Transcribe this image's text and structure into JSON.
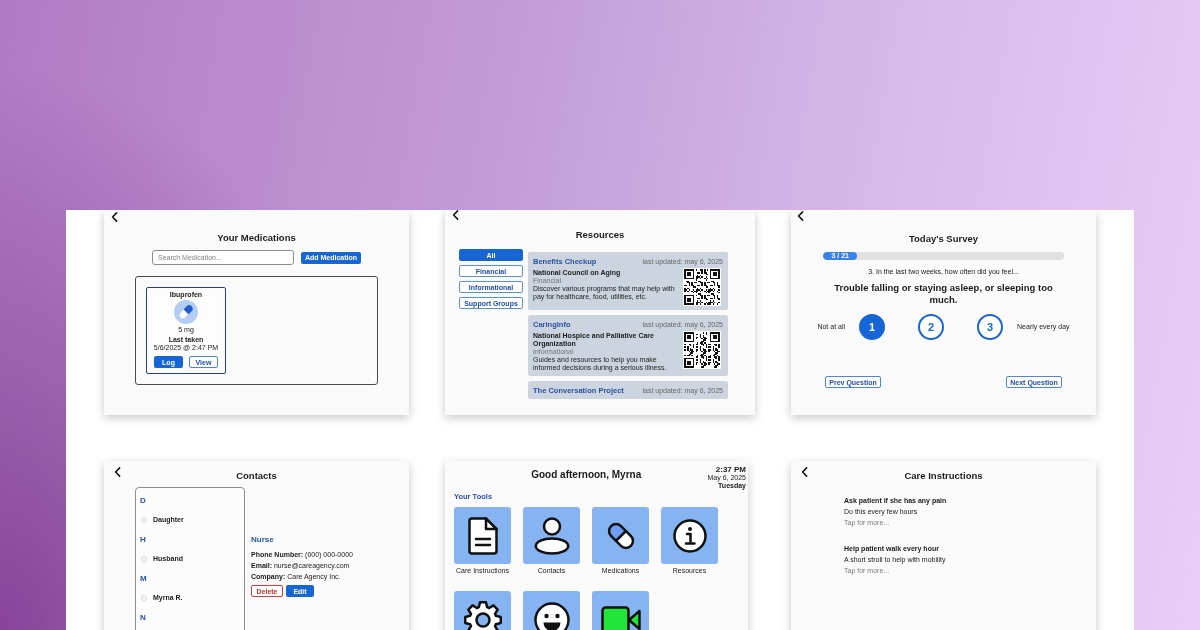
{
  "medications_screen": {
    "title": "Your Medications",
    "search": {
      "placeholder": "Search Medication..."
    },
    "add_button": "Add Medication",
    "medications": [
      {
        "name": "Ibuprofen",
        "dose": "5 mg",
        "last_taken_label": "Last taken",
        "last_taken": "5/6/2025 @ 2:47 PM",
        "log_button": "Log",
        "view_button": "View"
      }
    ]
  },
  "resources_screen": {
    "title": "Resources",
    "filters": [
      {
        "label": "All",
        "selected": true
      },
      {
        "label": "Financial",
        "selected": false
      },
      {
        "label": "Informational",
        "selected": false
      },
      {
        "label": "Support Groups",
        "selected": false
      }
    ],
    "resources": [
      {
        "title": "Benefits Checkup",
        "updated": "last updated: may 6, 2025",
        "organization": "National Council on Aging",
        "category": "Financial",
        "description": "Discover various programs that may help with pay for healthcare, food, utilities, etc."
      },
      {
        "title": "CaringInfo",
        "updated": "last updated: may 6, 2025",
        "organization": "National Hospice and Palliative Care Organization",
        "category": "Informational",
        "description": "Guides and resources to help you make informed decisions during a serious illness."
      },
      {
        "title": "The Conversation Project",
        "updated": "last updated: may 6, 2025"
      }
    ]
  },
  "survey_screen": {
    "title": "Today's Survey",
    "progress": {
      "label": "3 / 21",
      "level": 0.143
    },
    "prompt": "3. In the last two weeks, how often did you feel...",
    "question": "Trouble falling or staying asleep, or sleeping too much.",
    "low_label": "Not at all",
    "high_label": "Nearly every day",
    "options": [
      {
        "label": "1",
        "selected": true
      },
      {
        "label": "2",
        "selected": false
      },
      {
        "label": "3",
        "selected": false
      }
    ],
    "prev_button": "Prev Question",
    "next_button": "Next Question"
  },
  "contacts_screen": {
    "title": "Contacts",
    "groups": [
      {
        "letter": "D",
        "contacts": [
          {
            "name": "Daughter"
          }
        ]
      },
      {
        "letter": "H",
        "contacts": [
          {
            "name": "Husband"
          }
        ]
      },
      {
        "letter": "M",
        "contacts": [
          {
            "name": "Myrna R."
          }
        ]
      },
      {
        "letter": "N"
      }
    ],
    "detail": {
      "name": "Nurse",
      "fields": [
        "**Phone Number:** (000) 000-0000",
        "**Email:** nurse@careagency.com",
        "**Company:** Care Agency Inc."
      ],
      "delete_button": "Delete",
      "edit_button": "Edit"
    }
  },
  "home_screen": {
    "greeting": "Good afternoon, Myrna",
    "clock": {
      "time": "2:37 PM",
      "date": "May 6, 2025",
      "weekday": "Tuesday"
    },
    "section_title": "Your Tools",
    "tools": [
      {
        "kind": "document",
        "label": "Care Instructions"
      },
      {
        "kind": "person",
        "label": "Contacts"
      },
      {
        "kind": "pill",
        "label": "Medications"
      },
      {
        "kind": "info",
        "label": "Resources"
      },
      {
        "kind": "gear"
      },
      {
        "kind": "smiley"
      },
      {
        "kind": "video"
      }
    ]
  },
  "care_instructions_screen": {
    "title": "Care Instructions",
    "instructions": [
      {
        "title": "Ask patient if she has any pain",
        "detail": "Do this every few hours",
        "more": "Tap for more..."
      },
      {
        "title": "Help patient walk every hour",
        "detail": "A short stroll to help with mobility",
        "more": "Tap for more..."
      }
    ]
  }
}
